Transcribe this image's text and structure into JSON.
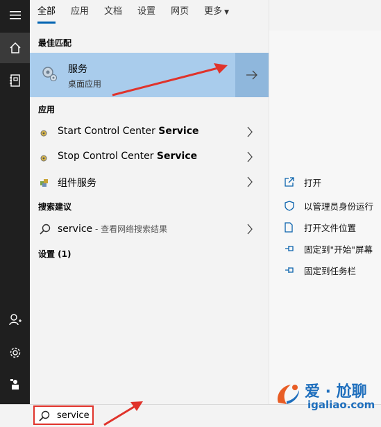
{
  "tabs": [
    {
      "label": "全部"
    },
    {
      "label": "应用"
    },
    {
      "label": "文档"
    },
    {
      "label": "设置"
    },
    {
      "label": "网页"
    },
    {
      "label": "更多"
    }
  ],
  "sections": {
    "best_match": "最佳匹配",
    "apps": "应用",
    "suggestions": "搜索建议",
    "settings": "设置 (1)"
  },
  "best_match": {
    "title": "服务",
    "subtitle": "桌面应用"
  },
  "apps": [
    {
      "prefix": "Start Control Center ",
      "bold": "Service"
    },
    {
      "prefix": "Stop Control Center ",
      "bold": "Service"
    },
    {
      "prefix": "组件服务",
      "bold": ""
    }
  ],
  "suggestion": {
    "query": "service",
    "sub": " - 查看网络搜索结果"
  },
  "actions": [
    {
      "label": "打开",
      "icon": "open-icon"
    },
    {
      "label": "以管理员身份运行",
      "icon": "shield-icon"
    },
    {
      "label": "打开文件位置",
      "icon": "file-location-icon"
    },
    {
      "label": "固定到\"开始\"屏幕",
      "icon": "pin-icon"
    },
    {
      "label": "固定到任务栏",
      "icon": "pin-icon"
    }
  ],
  "search": {
    "value": "service"
  },
  "watermark": {
    "line1": "爱 · 尬聊",
    "line2": "igaliao.com"
  },
  "colors": {
    "selected": "#a9ccec",
    "selected_arrow": "#8fb7dc",
    "accent": "#0063b1",
    "annotation": "#e0332b",
    "rail": "#1f1f1f"
  }
}
